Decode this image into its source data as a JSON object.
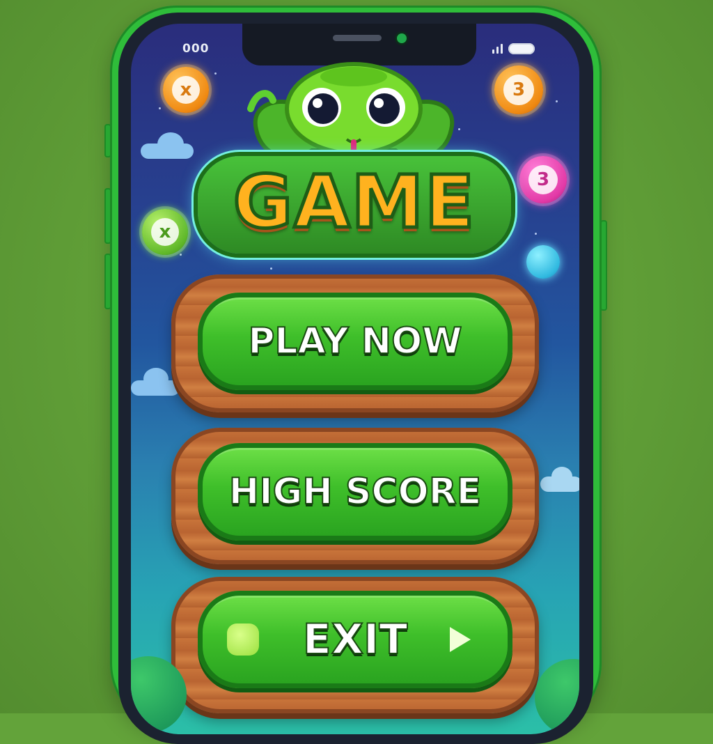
{
  "status_bar": {
    "signal_text": "000"
  },
  "game": {
    "title": "GAME"
  },
  "bubbles": {
    "top_left": "x",
    "top_right": "3",
    "right": "3",
    "left": "x"
  },
  "menu": {
    "play_label": "PLAY NOW",
    "high_score_label": "HIGH SCORE",
    "exit_label": "EXIT"
  },
  "icons": {
    "mascot": "snake-icon",
    "signal": "signal-icon",
    "battery": "battery-icon",
    "exit_left": "blob-icon",
    "exit_right": "play-arrow-icon"
  },
  "colors": {
    "background": "#63a33a",
    "phone_frame": "#2fbd3a",
    "button_green": "#3fbf2a",
    "wood": "#c8743a",
    "title_orange": "#ffb21f"
  }
}
